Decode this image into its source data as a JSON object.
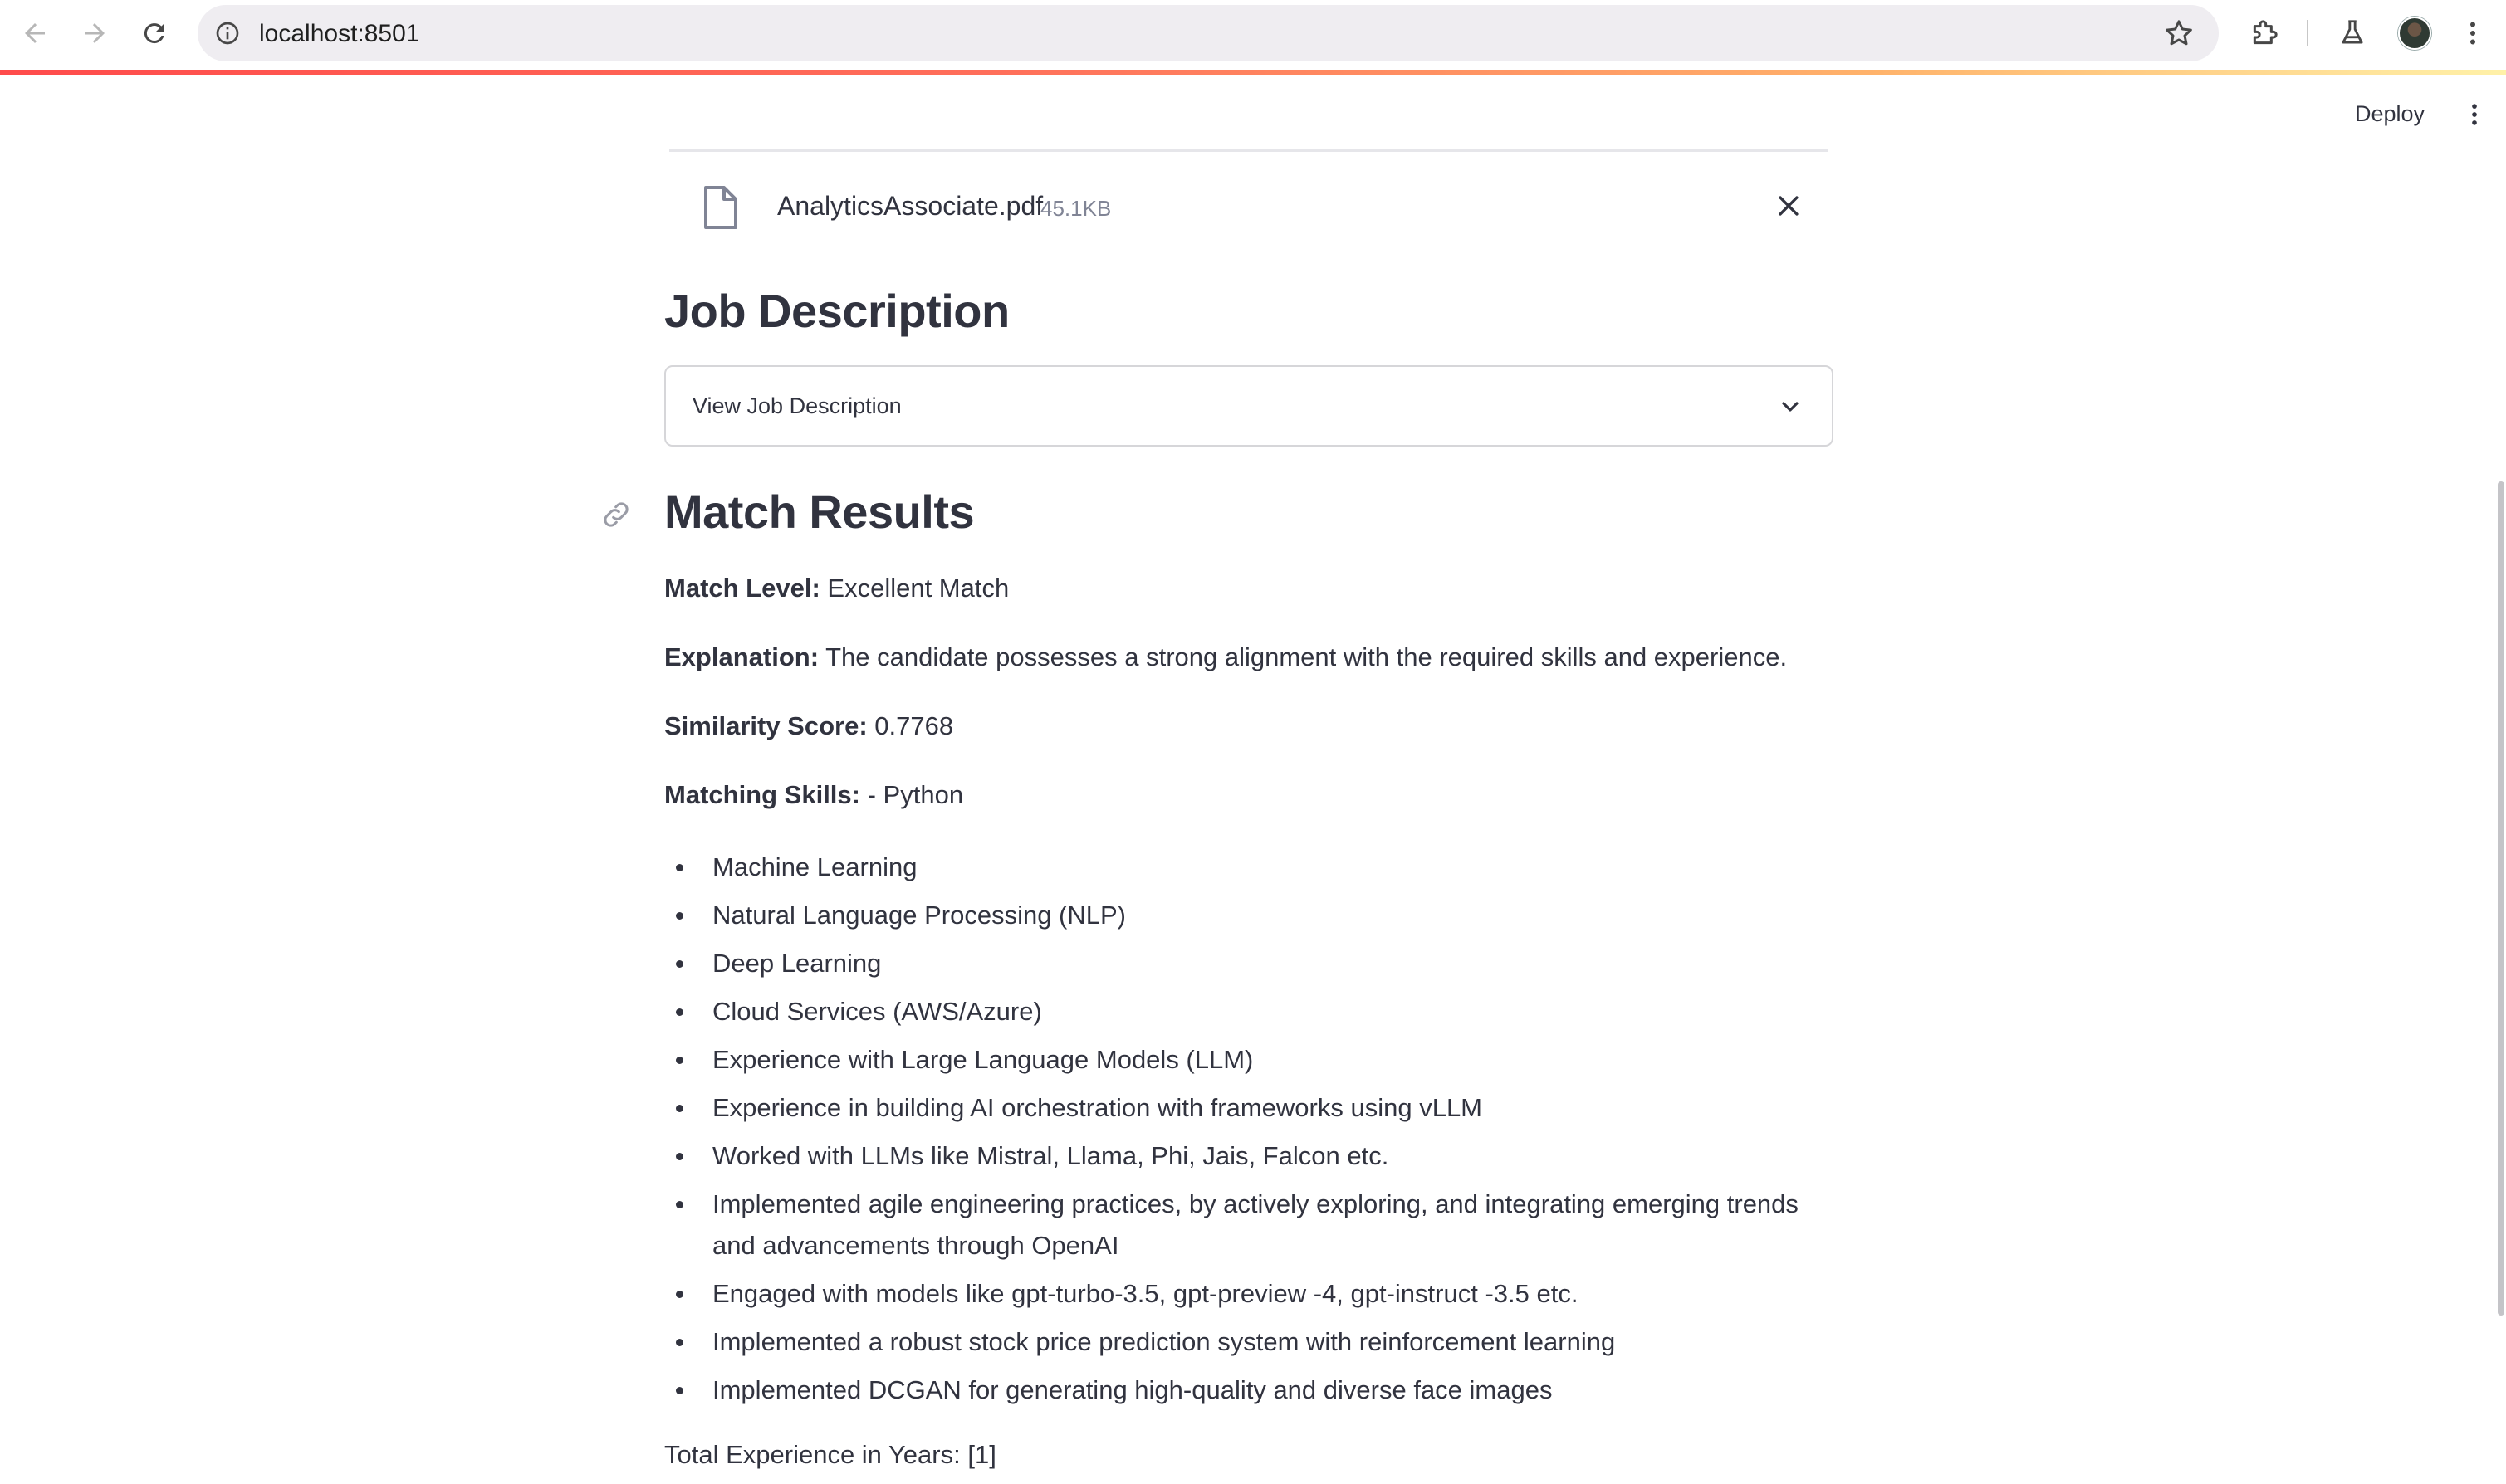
{
  "browser": {
    "url": "localhost:8501",
    "icons": [
      "back-arrow-icon",
      "forward-arrow-icon",
      "reload-icon",
      "site-info-icon",
      "bookmark-star-icon",
      "extensions-icon",
      "labs-flask-icon",
      "profile-avatar",
      "browser-menu-icon"
    ]
  },
  "app_header": {
    "deploy_label": "Deploy",
    "accent_colors": [
      "#ff4b4b",
      "#ffb36b",
      "#fff1a8"
    ]
  },
  "uploaded_file": {
    "name": "AnalyticsAssociate.pdf",
    "size": "45.1KB"
  },
  "job_description": {
    "heading": "Job Description",
    "expander_label": "View Job Description"
  },
  "match_results": {
    "heading": "Match Results",
    "match_level_label": "Match Level:",
    "match_level_value": "Excellent Match",
    "explanation_label": "Explanation:",
    "explanation_value": "The candidate possesses a strong alignment with the required skills and experience.",
    "similarity_label": "Similarity Score:",
    "similarity_value": "0.7768",
    "matching_skills_label": "Matching Skills:",
    "matching_skills_first": "- Python",
    "skills": [
      "Machine Learning",
      "Natural Language Processing (NLP)",
      "Deep Learning",
      "Cloud Services (AWS/Azure)",
      "Experience with Large Language Models (LLM)",
      "Experience in building AI orchestration with frameworks using vLLM",
      "Worked with LLMs like Mistral, Llama, Phi, Jais, Falcon etc.",
      "Implemented agile engineering practices, by actively exploring, and integrating emerging trends and advancements through OpenAI",
      "Engaged with models like gpt-turbo-3.5, gpt-preview -4, gpt-instruct -3.5 etc.",
      "Implemented a robust stock price prediction system with reinforcement learning",
      "Implemented DCGAN for generating high-quality and diverse face images"
    ],
    "total_experience": "Total Experience in Years: [1]"
  }
}
